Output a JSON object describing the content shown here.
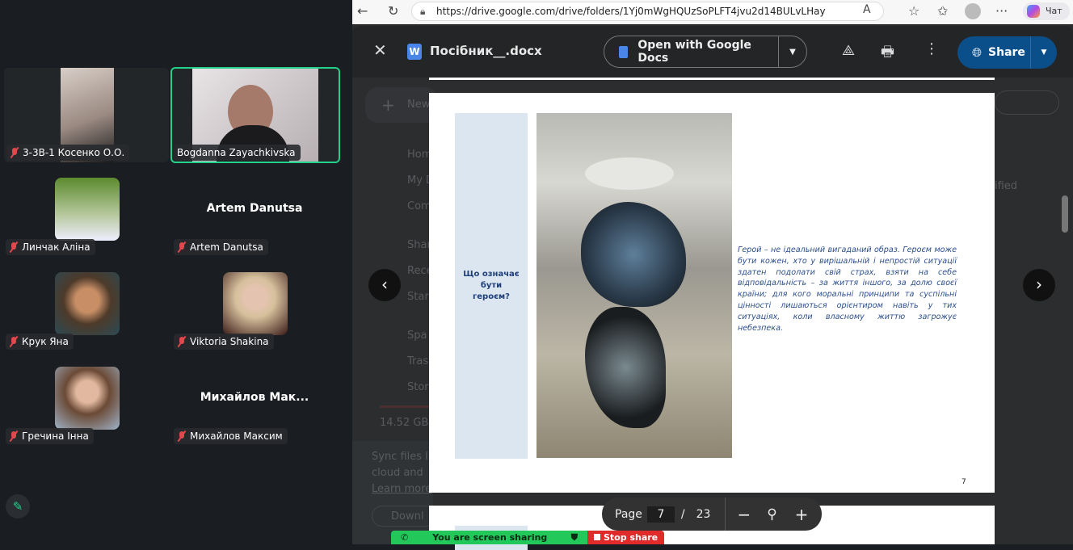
{
  "meeting": {
    "participants": [
      {
        "name": "3-3В-1 Косенко О.О.",
        "muted": true
      },
      {
        "name": "Bogdanna Zayachkivska",
        "muted": false,
        "active_speaker": true
      },
      {
        "name": "Линчак Аліна",
        "muted": true
      },
      {
        "name": "Artem Danutsa",
        "muted": true,
        "display": "Artem Danutsa"
      },
      {
        "name": "Крук Яна",
        "muted": true
      },
      {
        "name": "Viktoria Shakina",
        "muted": true
      },
      {
        "name": "Гречина Інна",
        "muted": true
      },
      {
        "name": "Михайлов Максим",
        "muted": true,
        "display": "Михайлов  Мак..."
      }
    ],
    "active_color": "#23d18b"
  },
  "browser": {
    "url": "https://drive.google.com/drive/folders/1Yj0mWgHQUzSoPLFT4jvu2d14BULvLHay",
    "copilot_label": "Чат"
  },
  "viewer": {
    "file_name": "Посібник__.docx",
    "open_with": "Open with Google Docs",
    "share": "Share",
    "page_label": "Page",
    "page_current": "7",
    "page_sep": "/",
    "page_total": "23",
    "doc": {
      "side_heading": "Що означає бути героєм?",
      "paragraph": "Герой – не ідеальний вигаданий образ. Героєм може бути кожен, хто у вирішальній і непростій ситуації здатен подолати свій страх, взяти на себе відповідальність – за життя іншого, за долю своєї країни; для кого моральні принципи та суспільні цінності лишаються орієнтиром навіть у тих ситуаціях, коли власному життю загрожує небезпека.",
      "page_number": "7"
    }
  },
  "drive_bg": {
    "items": [
      "New",
      "Home",
      "My D",
      "Com",
      "Shar",
      "Rece",
      "Star",
      "Spa",
      "Tras",
      "Stor"
    ],
    "storage": "14.52 GB",
    "sync": [
      "Sync files l",
      "cloud and"
    ],
    "learn": "Learn more",
    "download": "Downl",
    "modified": "ified"
  },
  "sharing": {
    "status": "You are screen sharing",
    "stop": "Stop share"
  }
}
